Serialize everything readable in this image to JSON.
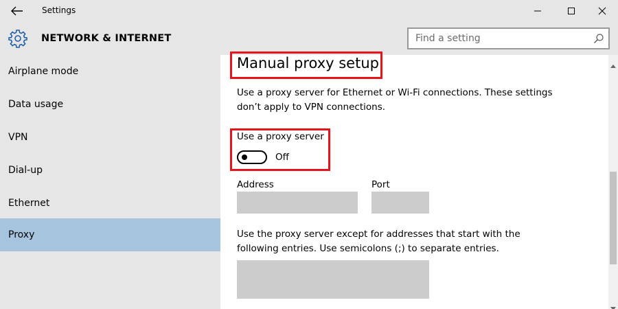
{
  "window": {
    "title": "Settings"
  },
  "header": {
    "section_title": "NETWORK & INTERNET",
    "search_placeholder": "Find a setting"
  },
  "sidebar": {
    "items": [
      {
        "label": "Airplane mode",
        "selected": false
      },
      {
        "label": "Data usage",
        "selected": false
      },
      {
        "label": "VPN",
        "selected": false
      },
      {
        "label": "Dial-up",
        "selected": false
      },
      {
        "label": "Ethernet",
        "selected": false
      },
      {
        "label": "Proxy",
        "selected": true
      }
    ]
  },
  "content": {
    "heading": "Manual proxy setup",
    "description_line1": "Use a proxy server for Ethernet or Wi-Fi connections. These settings",
    "description_line2": "don’t apply to VPN connections.",
    "proxy_toggle_label": "Use a proxy server",
    "proxy_toggle_state": "Off",
    "address_label": "Address",
    "address_value": "",
    "port_label": "Port",
    "port_value": "",
    "exceptions_line1": "Use the proxy server except for addresses that start with the",
    "exceptions_line2": "following entries. Use semicolons (;) to separate entries.",
    "exceptions_value": ""
  },
  "colors": {
    "chrome": "#e6e6e6",
    "selected_item": "#a6c4de",
    "highlight_box": "#e8141c",
    "field_bg": "#cccccc"
  },
  "icons": {
    "back": "back-arrow-icon",
    "section": "gear-icon",
    "search": "search-icon",
    "minimize": "minimize-icon",
    "maximize": "maximize-icon",
    "close": "close-icon"
  }
}
